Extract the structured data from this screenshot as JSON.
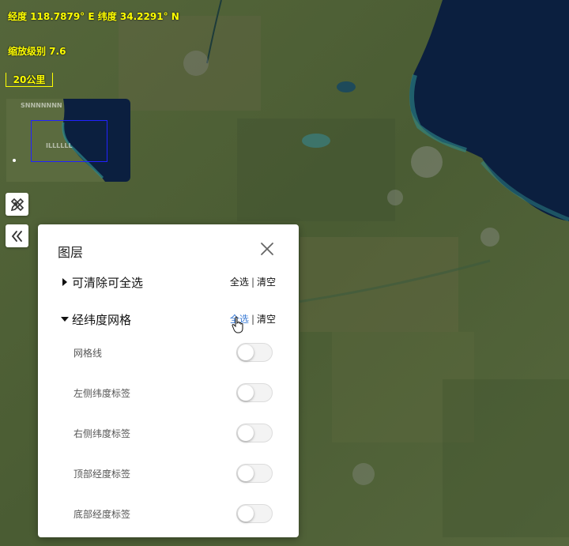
{
  "status": {
    "coordinates": "经度 118.7879° E  纬度 34.2291° N",
    "zoom": "缩放级别 7.6",
    "scale": "20公里"
  },
  "overview": {
    "label_top": "SNNNNNNN",
    "label_bottom": "ILLLLLL"
  },
  "tools": {
    "measure_icon": "ruler-pencil-icon",
    "collapse_icon": "double-chevron-left-icon"
  },
  "panel": {
    "title": "图层",
    "close_icon": "close-icon",
    "groups": [
      {
        "name": "可清除可全选",
        "expanded": false,
        "select_all": "全选",
        "separator": "|",
        "clear": "清空"
      },
      {
        "name": "经纬度网格",
        "expanded": true,
        "select_all": "全选",
        "separator": "|",
        "clear": "清空",
        "items": [
          {
            "label": "网格线",
            "on": false
          },
          {
            "label": "左侧纬度标签",
            "on": false
          },
          {
            "label": "右侧纬度标签",
            "on": false
          },
          {
            "label": "顶部经度标签",
            "on": false
          },
          {
            "label": "底部经度标签",
            "on": false
          }
        ]
      }
    ]
  },
  "colors": {
    "overlay_text": "#ffff00",
    "link_active": "#3a7bd5",
    "sea": "#0b1f3f"
  }
}
